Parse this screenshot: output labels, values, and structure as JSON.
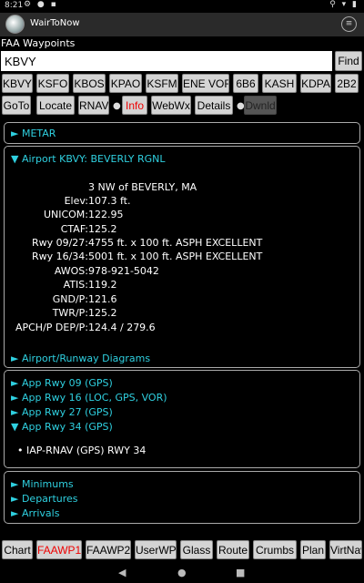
{
  "status": {
    "time": "8:21",
    "left_icons": "⚙ ● ▪",
    "right_icons": "⚲ ▾ ▮"
  },
  "app": {
    "title": "WairToNow",
    "menu_icon": "≡"
  },
  "waypoints": {
    "label": "FAA Waypoints",
    "search_value": "KBVY",
    "find_label": "Find"
  },
  "recent": [
    "KBVY",
    "KSFO",
    "KBOS",
    "KPAO",
    "KSFM",
    "ENE VOR",
    "6B6",
    "KASH",
    "KDPA",
    "2B2"
  ],
  "tools": {
    "goto": "GoTo",
    "locate": "Locate",
    "rnav": "RNAV",
    "info": "Info",
    "webwx": "WebWx",
    "details": "Details",
    "dwnld": "Dwnld",
    "dot": "●"
  },
  "metar": {
    "label": "► METAR"
  },
  "airport": {
    "header": "▼ Airport KBVY: BEVERLY RGNL",
    "location": "3 NW of BEVERLY, MA",
    "rows": [
      {
        "k": "Elev:",
        "v": "107.3 ft."
      },
      {
        "k": "UNICOM:",
        "v": "122.95"
      },
      {
        "k": "CTAF:",
        "v": "125.2"
      },
      {
        "k": "Rwy 09/27:",
        "v": "4755 ft. x 100 ft. ASPH EXCELLENT"
      },
      {
        "k": "Rwy 16/34:",
        "v": "5001 ft. x 100 ft. ASPH EXCELLENT"
      },
      {
        "k": "AWOS:",
        "v": "978-921-5042"
      },
      {
        "k": "ATIS:",
        "v": "119.2"
      },
      {
        "k": "GND/P:",
        "v": "121.6"
      },
      {
        "k": "TWR/P:",
        "v": "125.2"
      },
      {
        "k": "APCH/P DEP/P:",
        "v": "124.4 / 279.6"
      }
    ],
    "diagrams": "► Airport/Runway Diagrams"
  },
  "approaches": {
    "items": [
      "► App Rwy 09 (GPS)",
      "► App Rwy 16 (LOC, GPS, VOR)",
      "► App Rwy 27 (GPS)",
      "▼ App Rwy 34 (GPS)"
    ],
    "plate": "•  IAP-RNAV (GPS) RWY 34"
  },
  "other": {
    "items": [
      "► Minimums",
      "► Departures",
      "► Arrivals"
    ]
  },
  "bottom_tabs": [
    "Chart",
    "FAAWP1",
    "FAAWP2",
    "UserWP",
    "Glass",
    "Route",
    "Crumbs",
    "Plan",
    "VirtNav"
  ],
  "nav": {
    "back": "◀",
    "home": "●",
    "recents": "■"
  },
  "colors": {
    "accent": "#2fd0e0",
    "active_tab_text": "#e00000",
    "button_bg": "#d4d4d4"
  }
}
